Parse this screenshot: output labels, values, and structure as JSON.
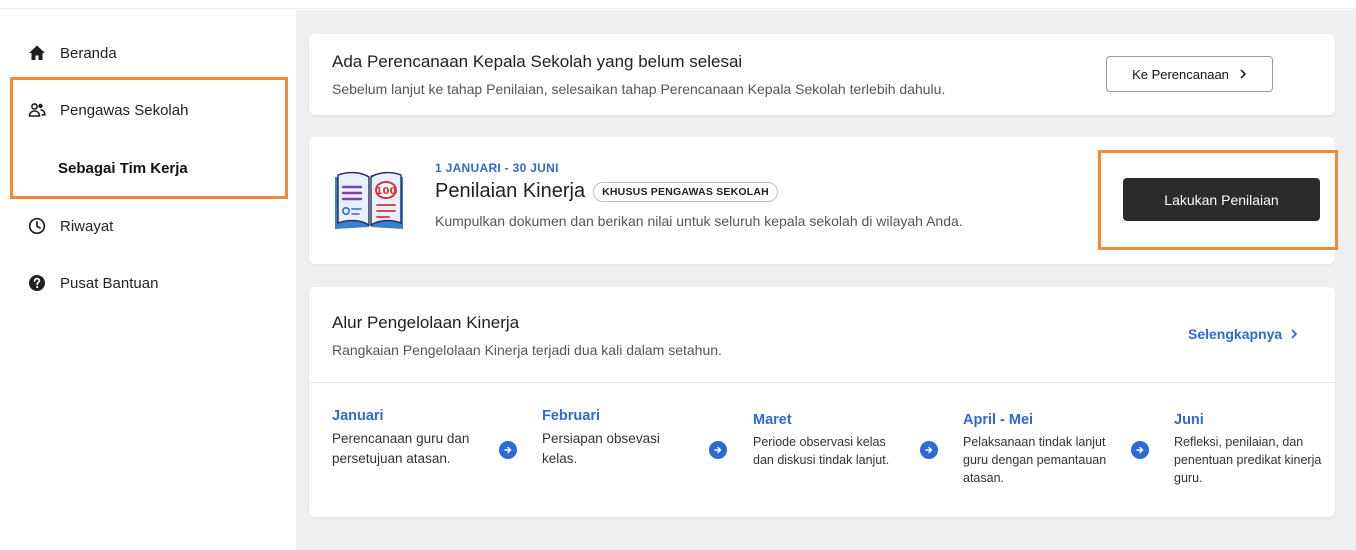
{
  "sidebar": {
    "items": [
      {
        "label": "Beranda",
        "icon": "home-icon"
      },
      {
        "label": "Pengawas Sekolah",
        "icon": "people-icon"
      },
      {
        "label": "Sebagai Tim Kerja"
      },
      {
        "label": "Riwayat",
        "icon": "clock-icon"
      },
      {
        "label": "Pusat Bantuan",
        "icon": "help-icon"
      }
    ]
  },
  "notice": {
    "title": "Ada Perencanaan Kepala Sekolah yang belum selesai",
    "subtitle": "Sebelum lanjut ke tahap Penilaian, selesaikan tahap Perencanaan Kepala Sekolah terlebih dahulu.",
    "button_label": "Ke Perencanaan"
  },
  "assessment": {
    "date_range": "1 JANUARI - 30 JUNI",
    "title": "Penilaian Kinerja",
    "badge": "KHUSUS PENGAWAS SEKOLAH",
    "subtitle": "Kumpulkan dokumen dan berikan nilai untuk seluruh kepala sekolah di wilayah Anda.",
    "button_label": "Lakukan Penilaian",
    "book_score": "100"
  },
  "flow": {
    "title": "Alur Pengelolaan Kinerja",
    "subtitle": "Rangkaian Pengelolaan Kinerja terjadi dua kali dalam setahun.",
    "link_label": "Selengkapnya",
    "steps": [
      {
        "month": "Januari",
        "desc": "Perencanaan guru dan persetujuan atasan."
      },
      {
        "month": "Februari",
        "desc": "Persiapan obsevasi kelas."
      },
      {
        "month": "Maret",
        "desc": "Periode observasi kelas dan diskusi tindak lanjut."
      },
      {
        "month": "April - Mei",
        "desc": "Pelaksanaan tindak lanjut guru dengan pemantauan atasan."
      },
      {
        "month": "Juni",
        "desc": "Refleksi, penilaian, dan penentuan predikat kinerja guru."
      }
    ]
  },
  "colors": {
    "accent": "#2d6ad6",
    "highlight": "#f08a34",
    "dark_button": "#2b2b2b",
    "background": "#efefef"
  }
}
